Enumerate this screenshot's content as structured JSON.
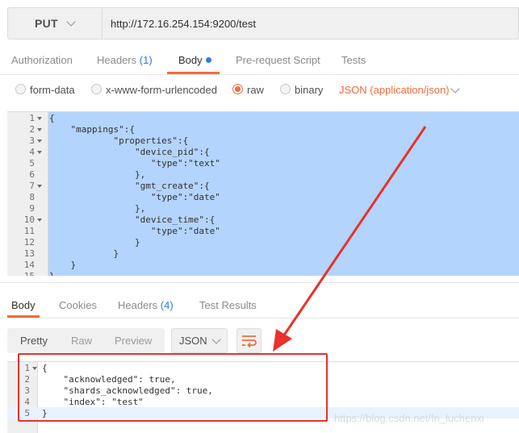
{
  "request": {
    "method": "PUT",
    "url": "http://172.16.254.154:9200/test"
  },
  "request_tabs": {
    "authorization": "Authorization",
    "headers": "Headers",
    "headers_count": "(1)",
    "body": "Body",
    "prerequest": "Pre-request Script",
    "tests": "Tests"
  },
  "body_options": {
    "form_data": "form-data",
    "urlencoded": "x-www-form-urlencoded",
    "raw": "raw",
    "binary": "binary",
    "content_type": "JSON (application/json)",
    "selected": "raw"
  },
  "request_body_lines": [
    {
      "n": "1",
      "text": "{"
    },
    {
      "n": "2",
      "text": "    \"mappings\":{"
    },
    {
      "n": "3",
      "text": "            \"properties\":{"
    },
    {
      "n": "4",
      "text": "                \"device_pid\":{"
    },
    {
      "n": "5",
      "text": "                   \"type\":\"text\""
    },
    {
      "n": "6",
      "text": "                },"
    },
    {
      "n": "7",
      "text": "                \"gmt_create\":{"
    },
    {
      "n": "8",
      "text": "                   \"type\":\"date\""
    },
    {
      "n": "9",
      "text": "                },"
    },
    {
      "n": "10",
      "text": "                \"device_time\":{"
    },
    {
      "n": "11",
      "text": "                   \"type\":\"date\""
    },
    {
      "n": "12",
      "text": "                }"
    },
    {
      "n": "13",
      "text": "            }"
    },
    {
      "n": "14",
      "text": "    }"
    },
    {
      "n": "15",
      "text": "}"
    }
  ],
  "response_tabs": {
    "body": "Body",
    "cookies": "Cookies",
    "headers": "Headers",
    "headers_count": "(4)",
    "test_results": "Test Results"
  },
  "response_view": {
    "pretty": "Pretty",
    "raw": "Raw",
    "preview": "Preview",
    "format": "JSON"
  },
  "response_body_lines": [
    {
      "n": "1",
      "text": "{"
    },
    {
      "n": "2",
      "text": "    \"acknowledged\": true,"
    },
    {
      "n": "3",
      "text": "    \"shards_acknowledged\": true,"
    },
    {
      "n": "4",
      "text": "    \"index\": \"test\""
    },
    {
      "n": "5",
      "text": "}"
    }
  ],
  "watermark": "https://blog.csdn.net/fn_luchenxi",
  "colors": {
    "accent": "#f26b3a",
    "selection": "#b3d4fc",
    "annotation": "#e8322c",
    "count": "#2a7ee0"
  }
}
